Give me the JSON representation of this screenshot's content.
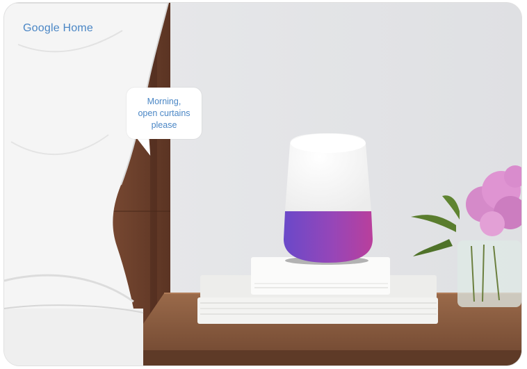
{
  "brand": {
    "title": "Google Home"
  },
  "speech_bubble": {
    "lines": [
      "Morning,",
      "open curtains",
      "please"
    ]
  },
  "colors": {
    "brand_text": "#4a86c5",
    "wall": "#e4e5e7",
    "speaker_top": "#f7f7f7",
    "speaker_base_start": "#6a49c9",
    "speaker_base_end": "#b93f9c",
    "nightstand": "#8a5b3f",
    "headboard": "#6b3e2a",
    "flower": "#d988c9"
  }
}
